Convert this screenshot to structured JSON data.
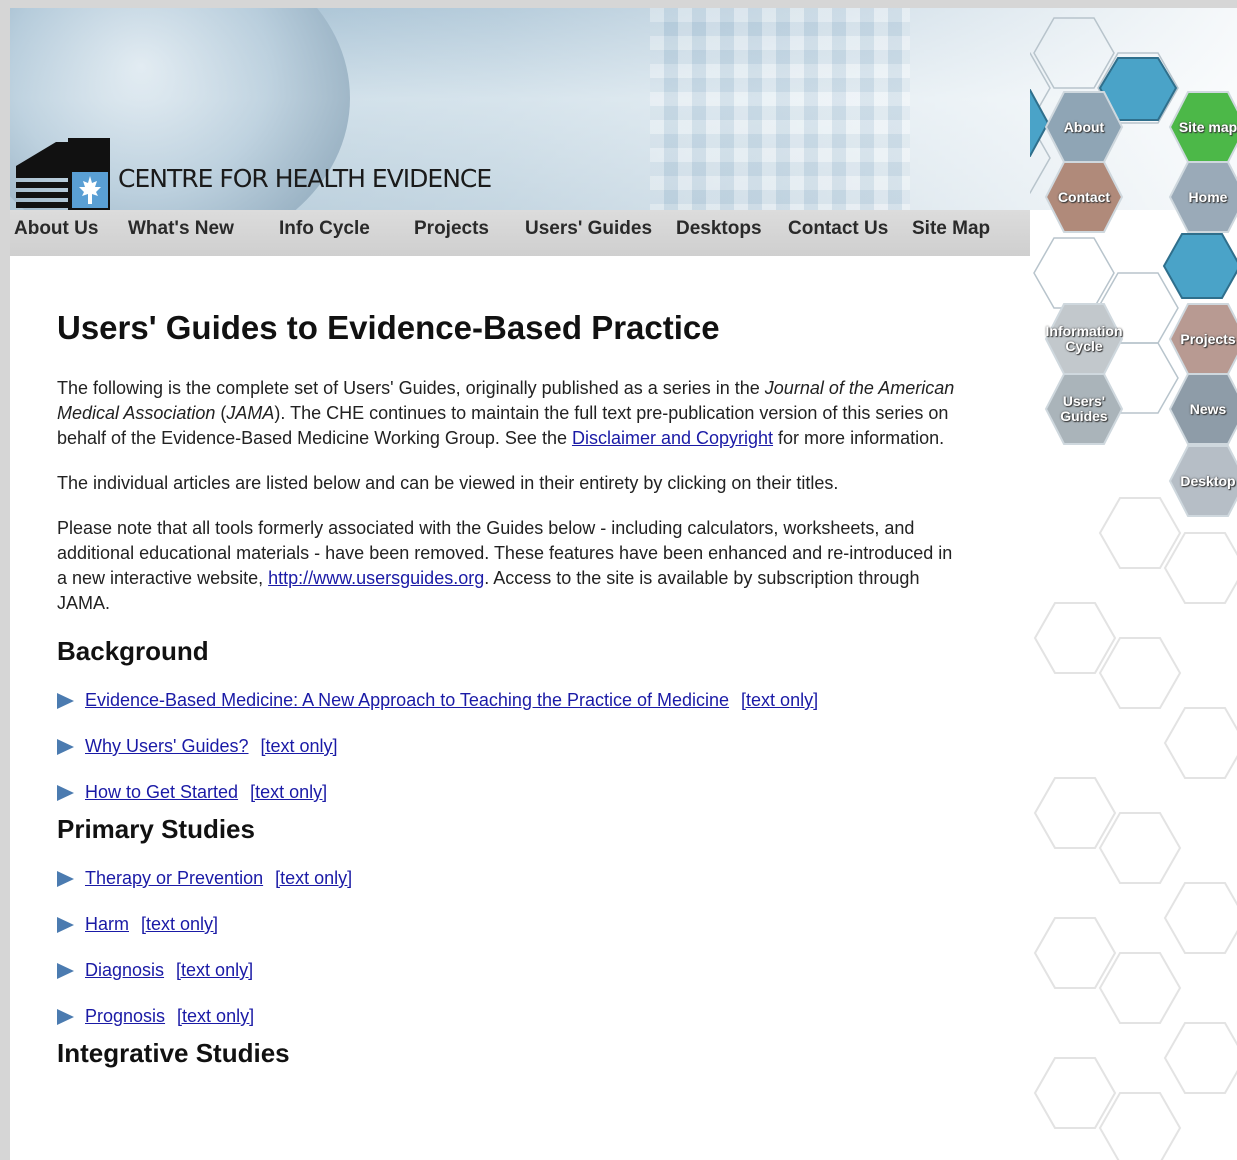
{
  "header": {
    "site_title": "CENTRE FOR HEALTH EVIDENCE"
  },
  "nav": {
    "items": [
      "About Us",
      "What's New",
      "Info Cycle",
      "Projects",
      "Users' Guides",
      "Desktops",
      "Contact Us",
      "Site Map"
    ]
  },
  "hexnav": {
    "about": "About",
    "site_map": "Site map",
    "contact": "Contact",
    "home": "Home",
    "information_cycle_line1": "Information",
    "information_cycle_line2": "Cycle",
    "projects": "Projects",
    "users_guides_line1": "Users'",
    "users_guides_line2": "Guides",
    "news": "News",
    "desktop": "Desktop"
  },
  "main": {
    "title": "Users' Guides to Evidence-Based Practice",
    "intro": {
      "part1": "The following is the complete set of Users' Guides, originally published as a series in the ",
      "journal_italic": "Journal of the American Medical Association",
      "part2": " (",
      "jama_italic": "JAMA",
      "part3": "). The CHE continues to maintain the full text pre-publication version of this series on behalf of the Evidence-Based Medicine Working Group. See the ",
      "disclaimer_link": "Disclaimer and Copyright",
      "part4": " for more information."
    },
    "para2": "The individual articles are listed below and can be viewed in their entirety by clicking on their titles.",
    "para3": {
      "part1": "Please note that all tools formerly associated with the Guides below - including calculators, worksheets, and additional educational materials - have been removed. These features have been enhanced and re-introduced in a new interactive website, ",
      "link": "http://www.usersguides.org",
      "part2": ". Access to the site is available by subscription through JAMA."
    },
    "text_only_label": "[text only]",
    "sections": [
      {
        "heading": "Background",
        "items": [
          "Evidence-Based Medicine: A New Approach to Teaching the Practice of Medicine",
          "Why Users' Guides?",
          "How to Get Started"
        ]
      },
      {
        "heading": "Primary Studies",
        "items": [
          "Therapy or Prevention",
          "Harm",
          "Diagnosis",
          "Prognosis"
        ]
      },
      {
        "heading": "Integrative Studies",
        "items": []
      }
    ]
  },
  "colors": {
    "link": "#1a1aa6",
    "arrow": "#4b7bb0",
    "hex_blue": "#4aa3c8",
    "hex_green": "#4cb848"
  }
}
